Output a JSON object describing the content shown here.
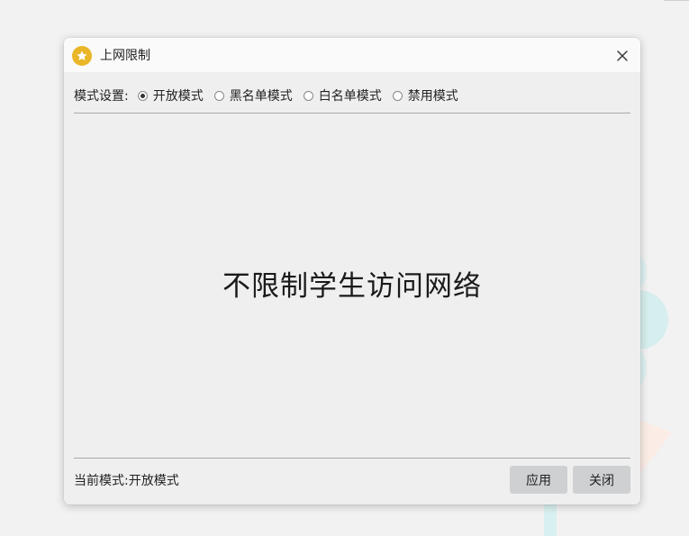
{
  "window": {
    "title": "上网限制",
    "app_icon": "star-icon",
    "close_icon": "close-icon",
    "accent_color": "#e9b628"
  },
  "mode_settings": {
    "label": "模式设置:",
    "options": [
      {
        "label": "开放模式",
        "checked": true
      },
      {
        "label": "黑名单模式",
        "checked": false
      },
      {
        "label": "白名单模式",
        "checked": false
      },
      {
        "label": "禁用模式",
        "checked": false
      }
    ]
  },
  "content": {
    "message": "不限制学生访问网络"
  },
  "footer": {
    "status_text": "当前模式:开放模式",
    "apply_label": "应用",
    "close_label": "关闭"
  }
}
